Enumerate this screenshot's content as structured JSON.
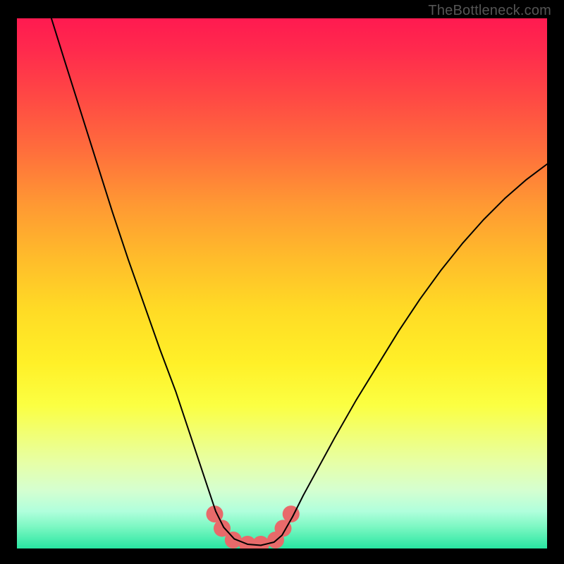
{
  "watermark": "TheBottleneck.com",
  "chart_data": {
    "type": "line",
    "title": "",
    "xlabel": "",
    "ylabel": "",
    "xlim": [
      0,
      100
    ],
    "ylim": [
      0,
      100
    ],
    "legend": false,
    "gradient_stops": [
      {
        "pos": 0.0,
        "color": "#ff1a50"
      },
      {
        "pos": 0.06,
        "color": "#ff2a4d"
      },
      {
        "pos": 0.15,
        "color": "#ff4944"
      },
      {
        "pos": 0.25,
        "color": "#ff6e3c"
      },
      {
        "pos": 0.35,
        "color": "#ff9833"
      },
      {
        "pos": 0.45,
        "color": "#ffbb2b"
      },
      {
        "pos": 0.55,
        "color": "#ffdb25"
      },
      {
        "pos": 0.65,
        "color": "#fff028"
      },
      {
        "pos": 0.73,
        "color": "#fbff42"
      },
      {
        "pos": 0.79,
        "color": "#f0ff7a"
      },
      {
        "pos": 0.84,
        "color": "#e6ffa8"
      },
      {
        "pos": 0.89,
        "color": "#d5ffd0"
      },
      {
        "pos": 0.93,
        "color": "#b0ffdc"
      },
      {
        "pos": 0.96,
        "color": "#7af7c2"
      },
      {
        "pos": 1.0,
        "color": "#28e6a1"
      }
    ],
    "series": [
      {
        "name": "bottleneck-curve",
        "color": "#000000",
        "points": [
          {
            "x": 6.5,
            "y": 100.0
          },
          {
            "x": 9.0,
            "y": 92.0
          },
          {
            "x": 12.0,
            "y": 82.5
          },
          {
            "x": 15.0,
            "y": 73.0
          },
          {
            "x": 18.0,
            "y": 63.5
          },
          {
            "x": 21.0,
            "y": 54.5
          },
          {
            "x": 24.0,
            "y": 46.0
          },
          {
            "x": 27.0,
            "y": 37.5
          },
          {
            "x": 30.0,
            "y": 29.5
          },
          {
            "x": 32.0,
            "y": 23.5
          },
          {
            "x": 34.0,
            "y": 17.5
          },
          {
            "x": 36.0,
            "y": 11.5
          },
          {
            "x": 37.5,
            "y": 7.0
          },
          {
            "x": 39.0,
            "y": 4.0
          },
          {
            "x": 41.0,
            "y": 1.8
          },
          {
            "x": 43.5,
            "y": 0.8
          },
          {
            "x": 46.0,
            "y": 0.6
          },
          {
            "x": 48.5,
            "y": 1.2
          },
          {
            "x": 50.0,
            "y": 2.5
          },
          {
            "x": 52.0,
            "y": 6.0
          },
          {
            "x": 54.0,
            "y": 10.0
          },
          {
            "x": 57.0,
            "y": 15.5
          },
          {
            "x": 60.0,
            "y": 21.0
          },
          {
            "x": 64.0,
            "y": 28.0
          },
          {
            "x": 68.0,
            "y": 34.5
          },
          {
            "x": 72.0,
            "y": 41.0
          },
          {
            "x": 76.0,
            "y": 47.0
          },
          {
            "x": 80.0,
            "y": 52.5
          },
          {
            "x": 84.0,
            "y": 57.5
          },
          {
            "x": 88.0,
            "y": 62.0
          },
          {
            "x": 92.0,
            "y": 66.0
          },
          {
            "x": 96.0,
            "y": 69.5
          },
          {
            "x": 100.0,
            "y": 72.5
          }
        ]
      }
    ],
    "markers": {
      "name": "highlight-dots",
      "color": "#e86a6a",
      "radius_pct": 1.6,
      "points": [
        {
          "x": 37.3,
          "y": 6.5
        },
        {
          "x": 38.7,
          "y": 3.8
        },
        {
          "x": 40.8,
          "y": 1.6
        },
        {
          "x": 43.5,
          "y": 0.8
        },
        {
          "x": 46.0,
          "y": 0.8
        },
        {
          "x": 48.8,
          "y": 1.6
        },
        {
          "x": 50.2,
          "y": 3.8
        },
        {
          "x": 51.7,
          "y": 6.5
        }
      ]
    }
  }
}
